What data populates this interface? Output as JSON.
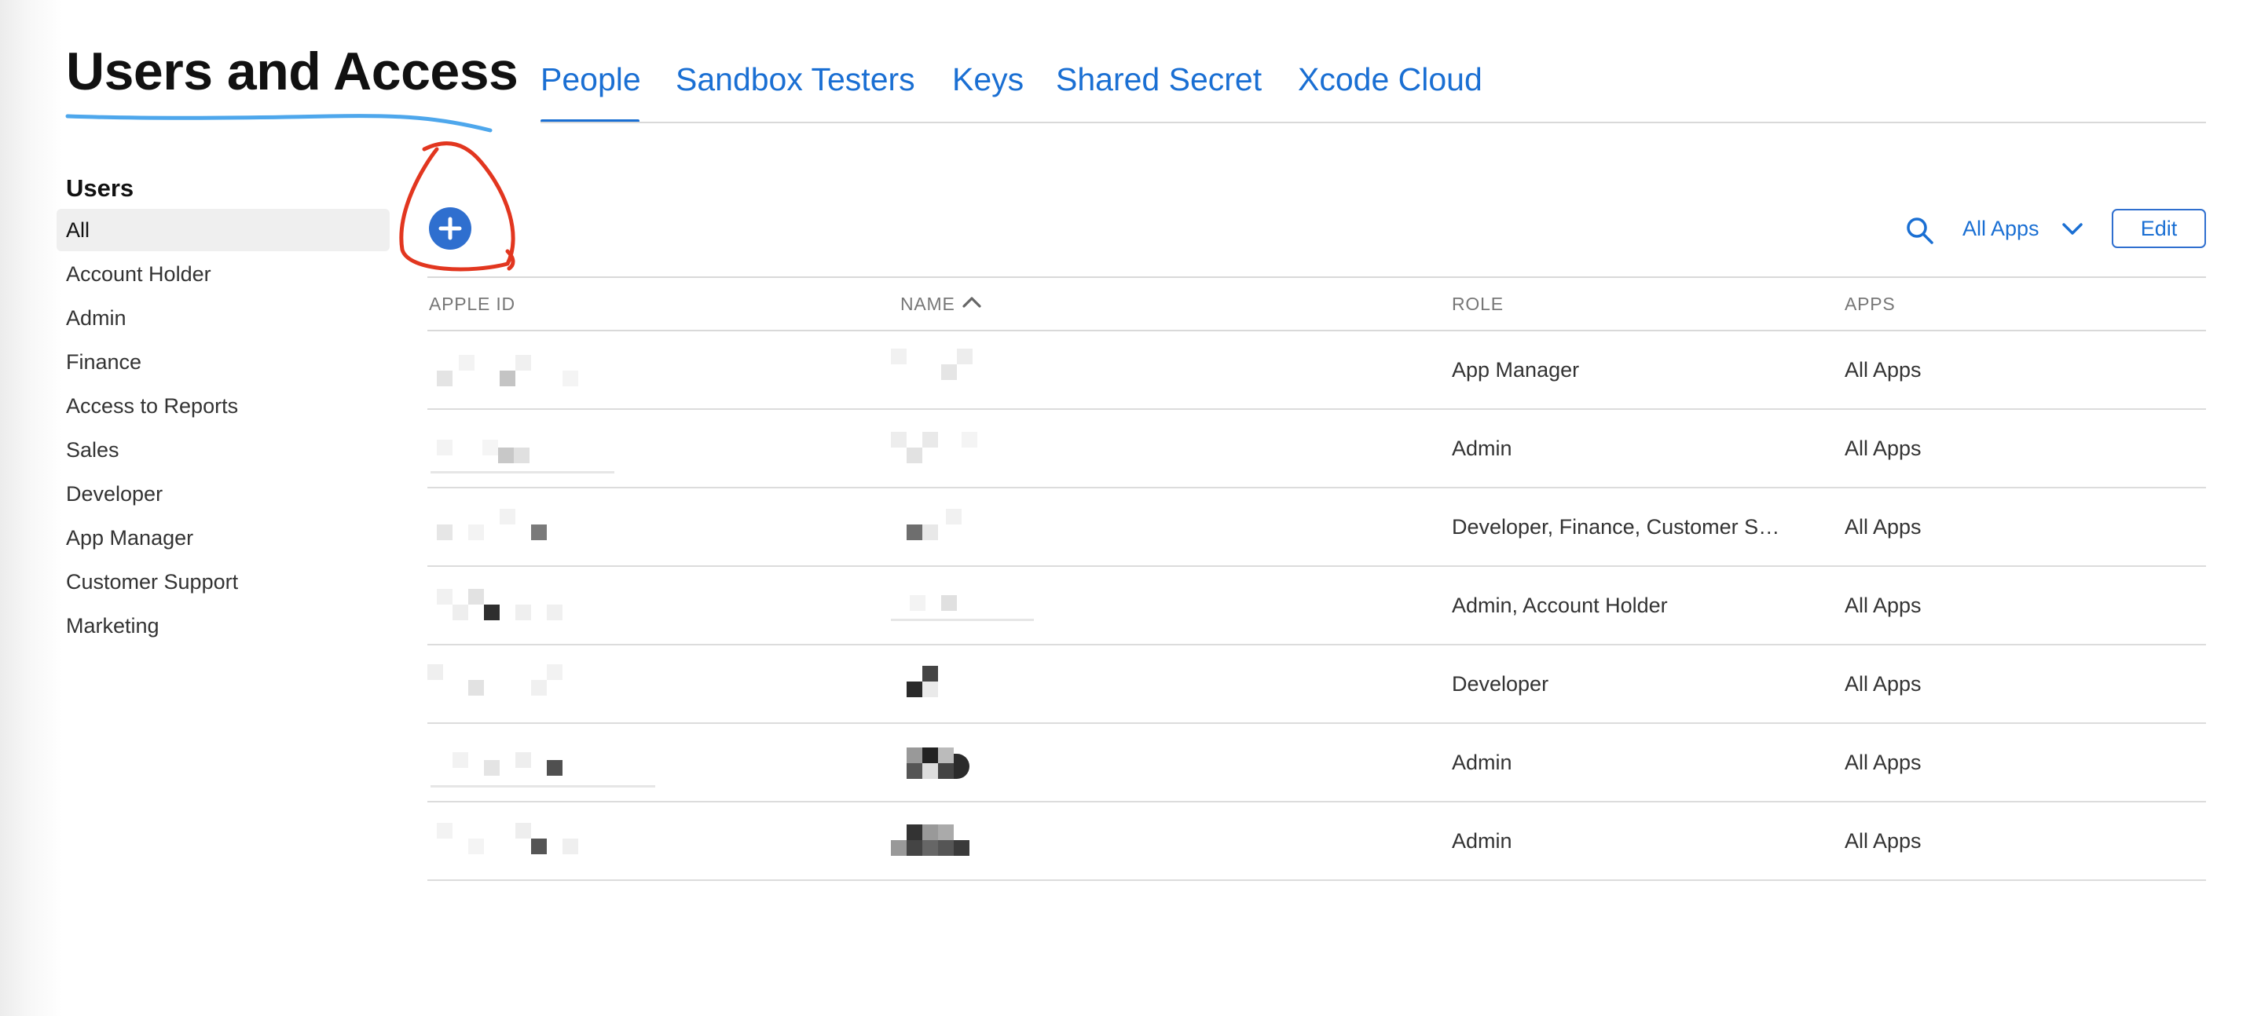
{
  "header": {
    "title": "Users and Access",
    "tabs": [
      {
        "label": "People",
        "selected": true
      },
      {
        "label": "Sandbox Testers"
      },
      {
        "label": "Keys"
      },
      {
        "label": "Shared Secret"
      },
      {
        "label": "Xcode Cloud"
      }
    ]
  },
  "sidebar": {
    "title": "Users",
    "items": [
      {
        "label": "All",
        "selected": true
      },
      {
        "label": "Account Holder"
      },
      {
        "label": "Admin"
      },
      {
        "label": "Finance"
      },
      {
        "label": "Access to Reports"
      },
      {
        "label": "Sales"
      },
      {
        "label": "Developer"
      },
      {
        "label": "App Manager"
      },
      {
        "label": "Customer Support"
      },
      {
        "label": "Marketing"
      }
    ]
  },
  "toolbar": {
    "add_icon": "plus-circle-icon",
    "search_icon": "search-icon",
    "filter_label": "All Apps",
    "filter_icon": "chevron-down-icon",
    "edit_label": "Edit"
  },
  "table": {
    "columns": [
      "APPLE ID",
      "NAME",
      "ROLE",
      "APPS"
    ],
    "sort_icon": "chevron-up-icon",
    "rows": [
      {
        "role": "App Manager",
        "apps": "All Apps"
      },
      {
        "role": "Admin",
        "apps": "All Apps"
      },
      {
        "role": "Developer, Finance, Customer Sup...",
        "apps": "All Apps"
      },
      {
        "role": "Admin, Account Holder",
        "apps": "All Apps"
      },
      {
        "role": "Developer",
        "apps": "All Apps"
      },
      {
        "role": "Admin",
        "apps": "All Apps"
      },
      {
        "role": "Admin",
        "apps": "All Apps"
      }
    ]
  },
  "colors": {
    "accent": "#1a6fd3",
    "button_fill": "#2f6fcf",
    "annotation_red": "#e2361f",
    "annotation_blue": "#4ea7ec"
  }
}
